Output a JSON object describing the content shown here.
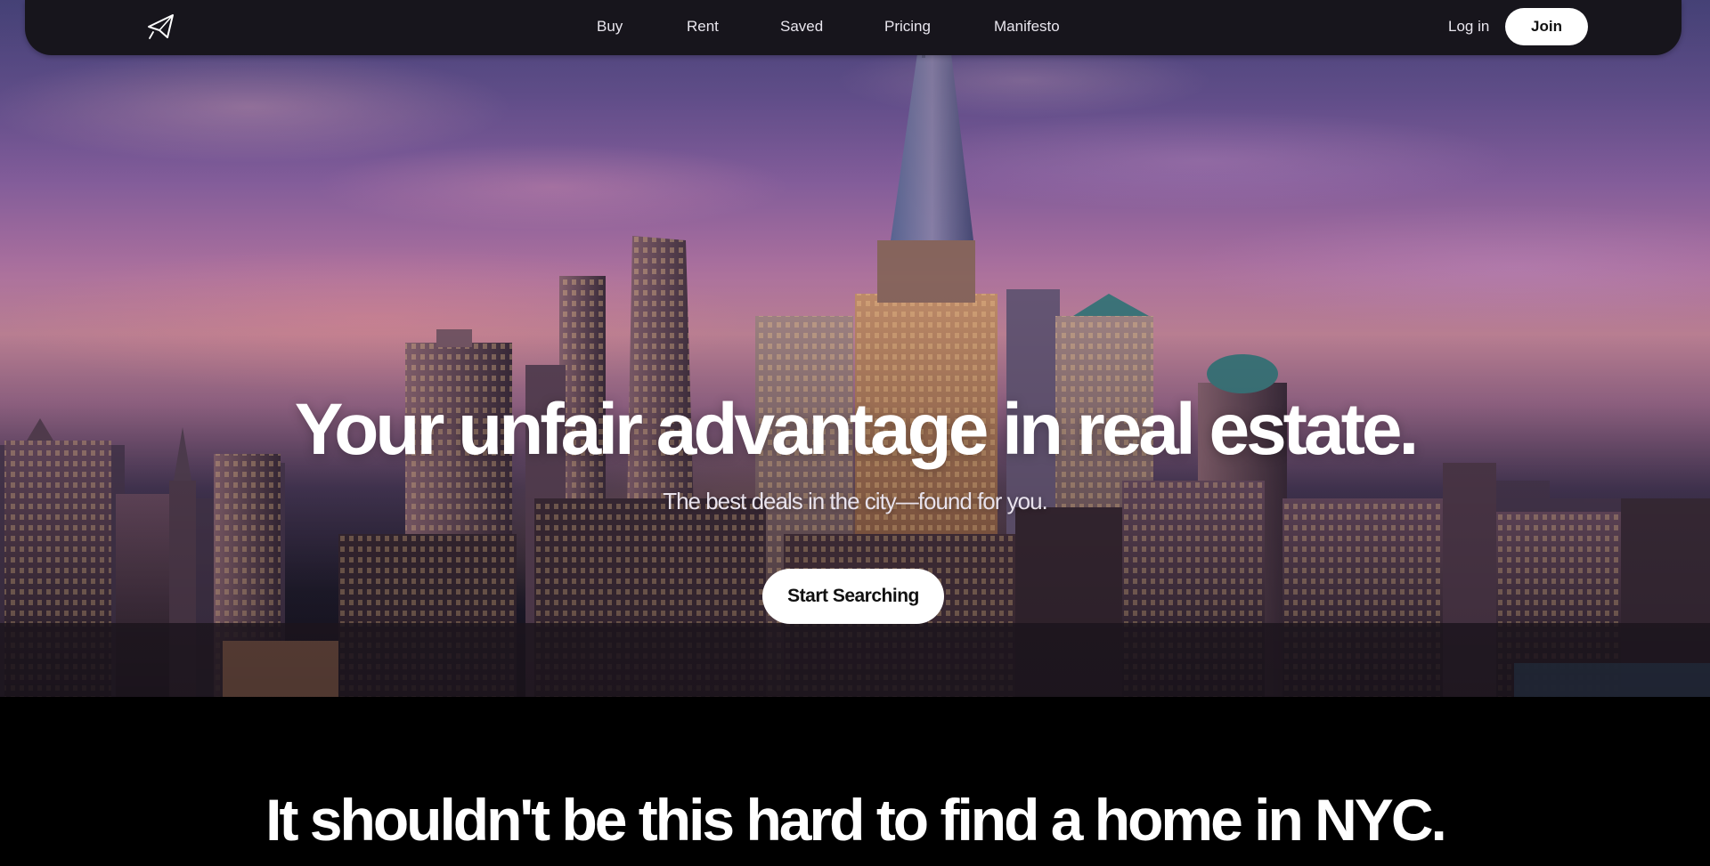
{
  "nav": {
    "logo_name": "paper-plane-logo-icon",
    "links": [
      {
        "label": "Buy"
      },
      {
        "label": "Rent"
      },
      {
        "label": "Saved"
      },
      {
        "label": "Pricing"
      },
      {
        "label": "Manifesto"
      }
    ],
    "login_label": "Log in",
    "join_label": "Join"
  },
  "hero": {
    "title": "Your unfair advantage in real estate.",
    "subtitle": "The best deals in the city—found for you.",
    "cta_label": "Start Searching"
  },
  "section": {
    "heading": "It shouldn't be this hard to find a home in NYC."
  },
  "colors": {
    "navbar_bg": "#17151c",
    "button_bg": "#ffffff",
    "page_bg": "#000000"
  }
}
